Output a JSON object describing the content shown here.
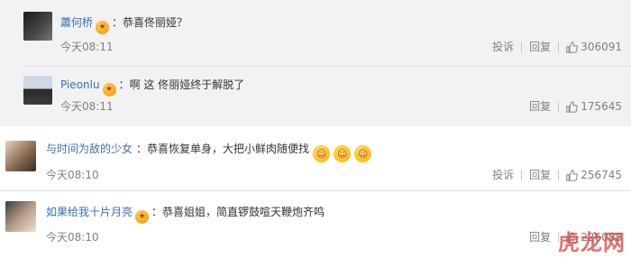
{
  "comments": [
    {
      "username": "蕭何桥",
      "colon": "：",
      "text": "恭喜佟丽娅？",
      "time": "今天08:11",
      "report": "投诉",
      "reply": "回复",
      "likes": "306091",
      "vip_icon": "vip-crown-icon"
    },
    {
      "username": "Pieonlu",
      "colon": "：",
      "text": "啊 这 佟丽娅终于解脱了",
      "time": "今天08:11",
      "reply": "回复",
      "likes": "175645",
      "vip_icon": "vip-crown-icon"
    },
    {
      "username": "与时间为敌的少女",
      "colon": "：",
      "text": "恭喜恢复单身，大把小鲜肉随便找",
      "emoji_count": 3,
      "time": "今天08:10",
      "report": "投诉",
      "reply": "回复",
      "likes": "256745"
    },
    {
      "username": "如果给我十片月亮",
      "colon": "：",
      "text": "恭喜姐姐，简直锣鼓喧天鞭炮齐鸣",
      "time": "今天08:10",
      "reply": "回复",
      "likes": "226088",
      "vip_icon": "vip-crown-icon"
    }
  ],
  "watermark": "虎龙网",
  "colors": {
    "username": "#3b6fb6",
    "meta": "#808080",
    "block_bg": "#f2f2f5",
    "watermark": "#d9433d"
  }
}
